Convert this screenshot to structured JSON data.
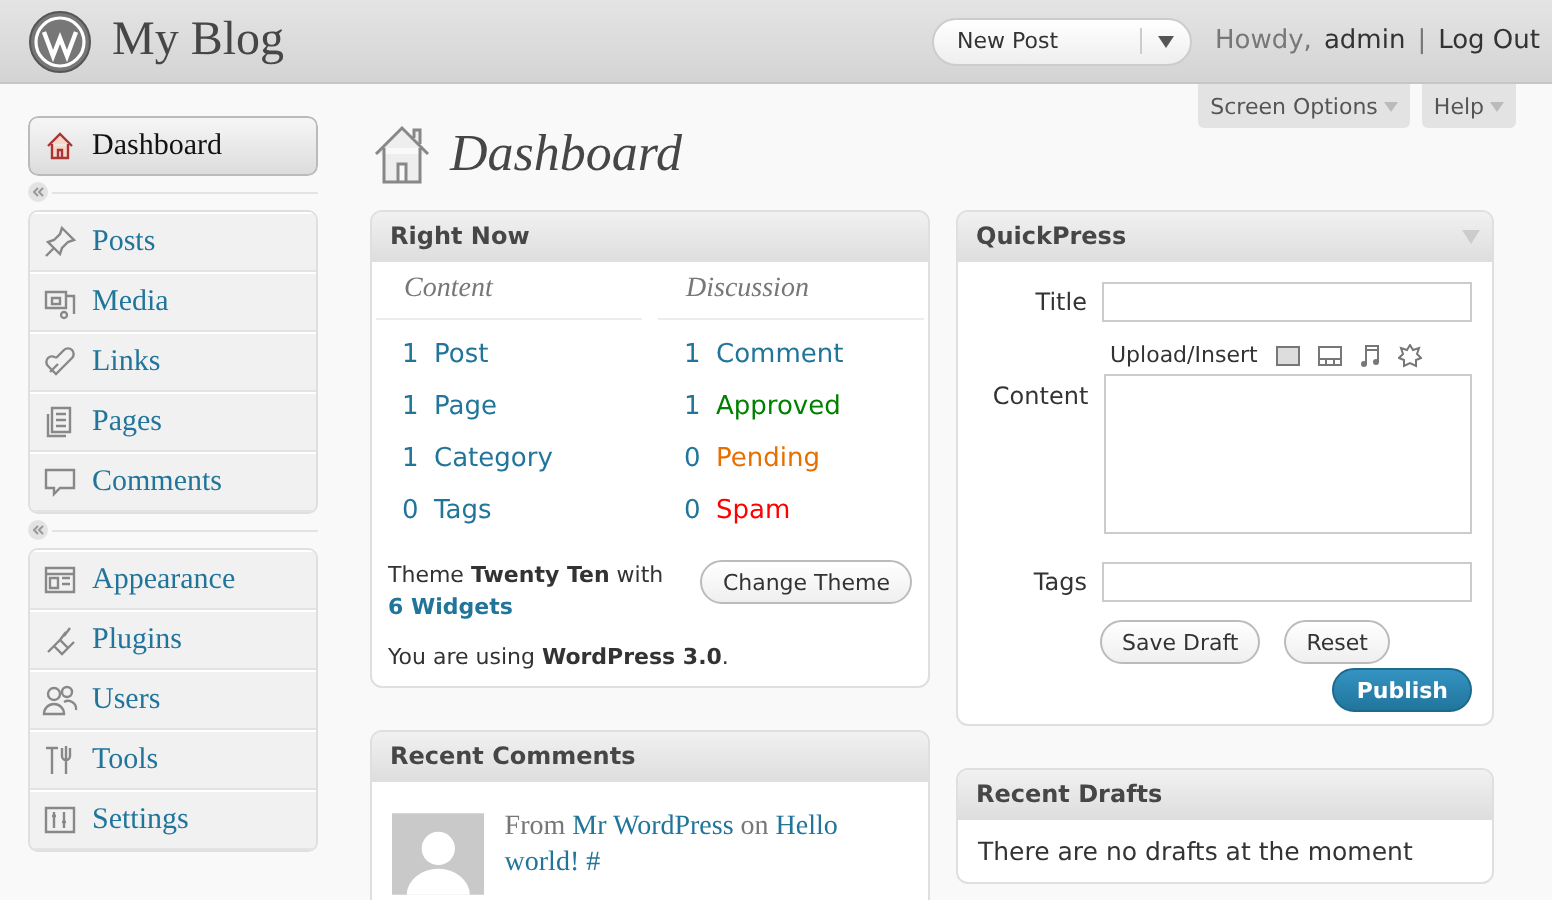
{
  "header": {
    "site_title": "My Blog",
    "new_post": "New Post",
    "greeting": "Howdy,",
    "user": "admin",
    "separator": "|",
    "logout": "Log Out"
  },
  "screen_tabs": [
    "Screen Options",
    "Help"
  ],
  "page_title": "Dashboard",
  "menu_groups": [
    [
      {
        "label": "Dashboard",
        "selected": true
      }
    ],
    [
      {
        "label": "Posts",
        "selected": false
      },
      {
        "label": "Media",
        "selected": false
      },
      {
        "label": "Links",
        "selected": false
      },
      {
        "label": "Pages",
        "selected": false
      },
      {
        "label": "Comments",
        "selected": false
      }
    ],
    [
      {
        "label": "Appearance",
        "selected": false
      },
      {
        "label": "Plugins",
        "selected": false
      },
      {
        "label": "Users",
        "selected": false
      },
      {
        "label": "Tools",
        "selected": false
      },
      {
        "label": "Settings",
        "selected": false
      }
    ]
  ],
  "right_now": {
    "title": "Right Now",
    "content_heading": "Content",
    "discussion_heading": "Discussion",
    "content": [
      {
        "count": "1",
        "label": "Post"
      },
      {
        "count": "1",
        "label": "Page"
      },
      {
        "count": "1",
        "label": "Category"
      },
      {
        "count": "0",
        "label": "Tags"
      }
    ],
    "discussion": [
      {
        "count": "1",
        "label": "Comment",
        "color": "#21759b"
      },
      {
        "count": "1",
        "label": "Approved",
        "color": "#008000"
      },
      {
        "count": "0",
        "label": "Pending",
        "color": "#e66f00"
      },
      {
        "count": "0",
        "label": "Spam",
        "color": "#ff0000"
      }
    ],
    "theme_text": "Theme **Twenty Ten** with",
    "widgets": "6 Widgets",
    "change_theme": "Change Theme",
    "version_text": "You are using **WordPress 3.0**."
  },
  "recent_comments": {
    "title": "Recent Comments",
    "from": "From",
    "author": "Mr WordPress",
    "on": "on",
    "post": "Hello world! #"
  },
  "quickpress": {
    "title": "QuickPress",
    "title_label": "Title",
    "upload_label": "Upload/Insert",
    "content_label": "Content",
    "tags_label": "Tags",
    "save_draft": "Save Draft",
    "reset": "Reset",
    "publish": "Publish"
  },
  "recent_drafts": {
    "title": "Recent Drafts",
    "empty": "There are no drafts at the moment"
  }
}
